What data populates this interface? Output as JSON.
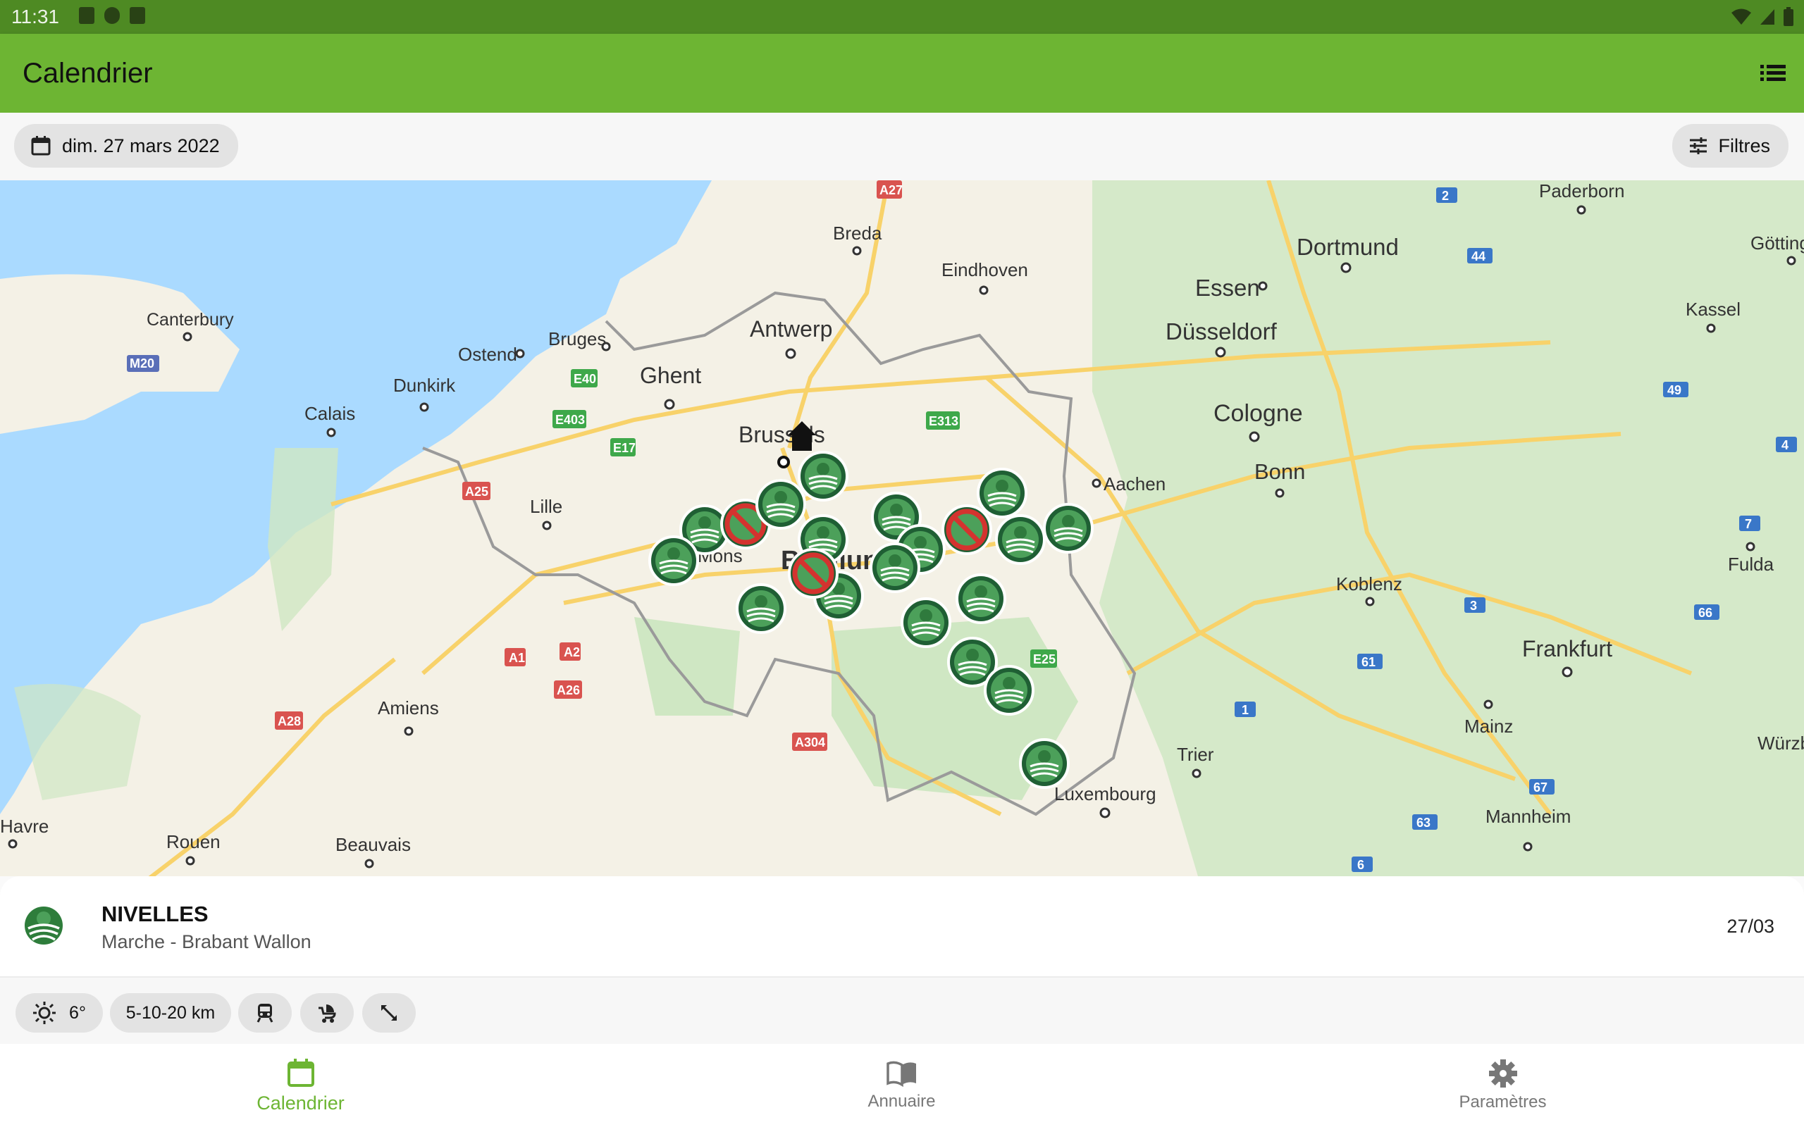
{
  "status_bar": {
    "time": "11:31",
    "icons": [
      "a-icon",
      "p-icon",
      "sd-icon"
    ],
    "right_icons": [
      "wifi-icon",
      "signal-icon",
      "battery-icon"
    ]
  },
  "app_bar": {
    "title": "Calendrier",
    "menu_icon": "list-icon"
  },
  "toolbar": {
    "date_label": "dim. 27 mars 2022",
    "filters_label": "Filtres"
  },
  "map": {
    "cities": [
      "Breda",
      "Eindhoven",
      "Antwerp",
      "Ghent",
      "Bruges",
      "Ostend",
      "Dunkirk",
      "Calais",
      "Canterbury",
      "Brussels",
      "Lille",
      "Mons",
      "Belgium",
      "Aachen",
      "Cologne",
      "Bonn",
      "Düsseldorf",
      "Essen",
      "Dortmund",
      "Paderborn",
      "Götting",
      "Kassel",
      "Koblenz",
      "Fulda",
      "Frankfurt",
      "Mainz",
      "Mannheim",
      "Würzb",
      "Trier",
      "Luxembourg",
      "Amiens",
      "Rouen",
      "Beauvais",
      "Havre"
    ],
    "roads": [
      "A27",
      "E40",
      "E403",
      "E17",
      "E313",
      "A25",
      "A1",
      "A2",
      "A26",
      "A28",
      "A304",
      "E25",
      "M20",
      "2",
      "44",
      "49",
      "4",
      "7",
      "3",
      "66",
      "61",
      "1",
      "67",
      "63",
      "6"
    ]
  },
  "colors": {
    "statusbar": "#4e8a23",
    "appbar": "#6db533",
    "accent": "#6db533",
    "marker_dark": "#1f5f34"
  },
  "event": {
    "name": "NIVELLES",
    "subtitle": "Marche - Brabant Wallon",
    "date": "27/03"
  },
  "event_chips": {
    "weather_icon": "sun-icon",
    "temperature": "6°",
    "distances": "5-10-20 km",
    "train_icon": "train-icon",
    "stroller_icon": "stroller-icon",
    "route_icon": "route-icon"
  },
  "nav": {
    "calendar": {
      "label": "Calendrier",
      "icon": "calendar-icon"
    },
    "directory": {
      "label": "Annuaire",
      "icon": "book-icon"
    },
    "settings": {
      "label": "Paramètres",
      "icon": "gear-icon"
    }
  }
}
